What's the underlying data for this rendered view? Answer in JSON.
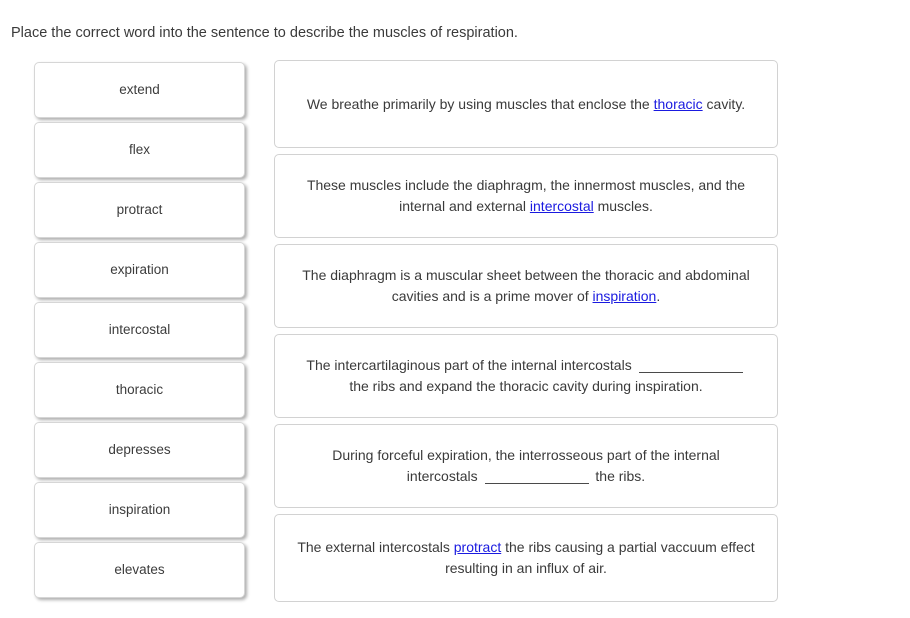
{
  "prompt": "Place the correct word into the sentence to describe the muscles of respiration.",
  "colors": {
    "answer_link": "#1a1ae0",
    "text": "#3a3a3a",
    "tile_border": "#d6d6d6",
    "card_border": "#d2d2d2",
    "page_background": "#ffffff"
  },
  "word_bank": {
    "items": [
      {
        "label": "extend"
      },
      {
        "label": "flex"
      },
      {
        "label": "protract"
      },
      {
        "label": "expiration"
      },
      {
        "label": "intercostal"
      },
      {
        "label": "thoracic"
      },
      {
        "label": "depresses"
      },
      {
        "label": "inspiration"
      },
      {
        "label": "elevates"
      }
    ]
  },
  "sentences": {
    "items": [
      {
        "id": "sentence-1",
        "before": "We breathe primarily by using muscles that enclose the ",
        "answer": "thoracic",
        "answer_state": "filled",
        "after": " cavity."
      },
      {
        "id": "sentence-2",
        "before": "These muscles include the diaphragm, the innermost muscles, and the internal and external ",
        "answer": "intercostal",
        "answer_state": "filled",
        "after": " muscles."
      },
      {
        "id": "sentence-3",
        "before": "The diaphragm is a muscular sheet between the thoracic and abdominal cavities and is a prime mover of ",
        "answer": "inspiration",
        "answer_state": "filled",
        "after": "."
      },
      {
        "id": "sentence-4",
        "before": "The intercartilaginous part of the internal intercostals ",
        "answer": "",
        "answer_state": "blank",
        "after": " the ribs and expand the thoracic cavity during inspiration."
      },
      {
        "id": "sentence-5",
        "before": "During forceful expiration, the interrosseous part of the internal intercostals ",
        "answer": "",
        "answer_state": "blank",
        "after": " the ribs."
      },
      {
        "id": "sentence-6",
        "before": "The external intercostals ",
        "answer": "protract",
        "answer_state": "filled",
        "after": " the ribs causing a partial vaccuum effect resulting in an influx of air."
      }
    ]
  }
}
